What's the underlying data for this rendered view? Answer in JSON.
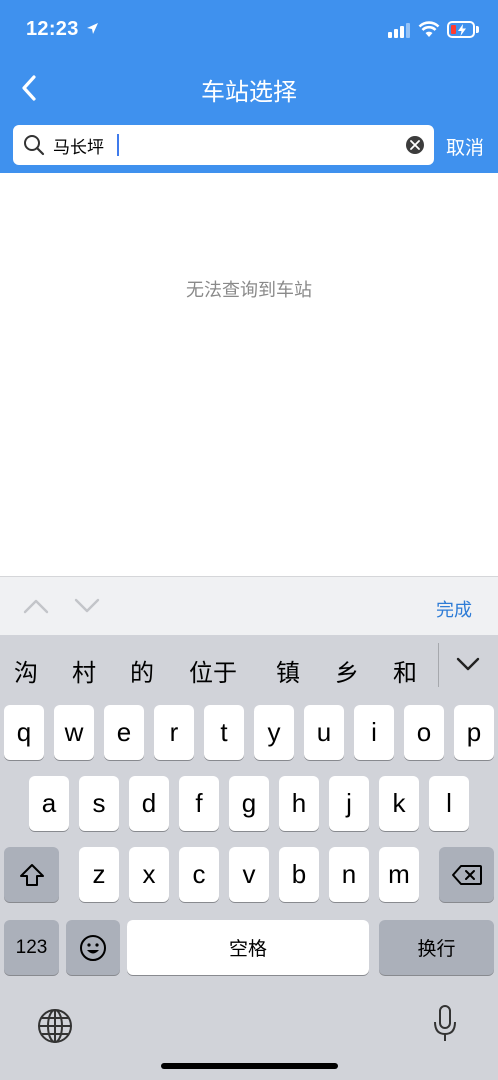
{
  "status_bar": {
    "time": "12:23"
  },
  "nav": {
    "title": "车站选择"
  },
  "search": {
    "value": "马长坪",
    "cancel_label": "取消"
  },
  "content": {
    "empty_message": "无法查询到车站"
  },
  "toolbar": {
    "done_label": "完成"
  },
  "keyboard": {
    "candidates": [
      "沟",
      "村",
      "的",
      "位于",
      "镇",
      "乡",
      "和"
    ],
    "row1": [
      "q",
      "w",
      "e",
      "r",
      "t",
      "y",
      "u",
      "i",
      "o",
      "p"
    ],
    "row2": [
      "a",
      "s",
      "d",
      "f",
      "g",
      "h",
      "j",
      "k",
      "l"
    ],
    "row3": [
      "z",
      "x",
      "c",
      "v",
      "b",
      "n",
      "m"
    ],
    "numbers_label": "123",
    "space_label": "空格",
    "return_label": "换行"
  },
  "colors": {
    "header": "#3f91ee",
    "accent": "#2e7cd6",
    "battery_low": "#ff3b30"
  }
}
